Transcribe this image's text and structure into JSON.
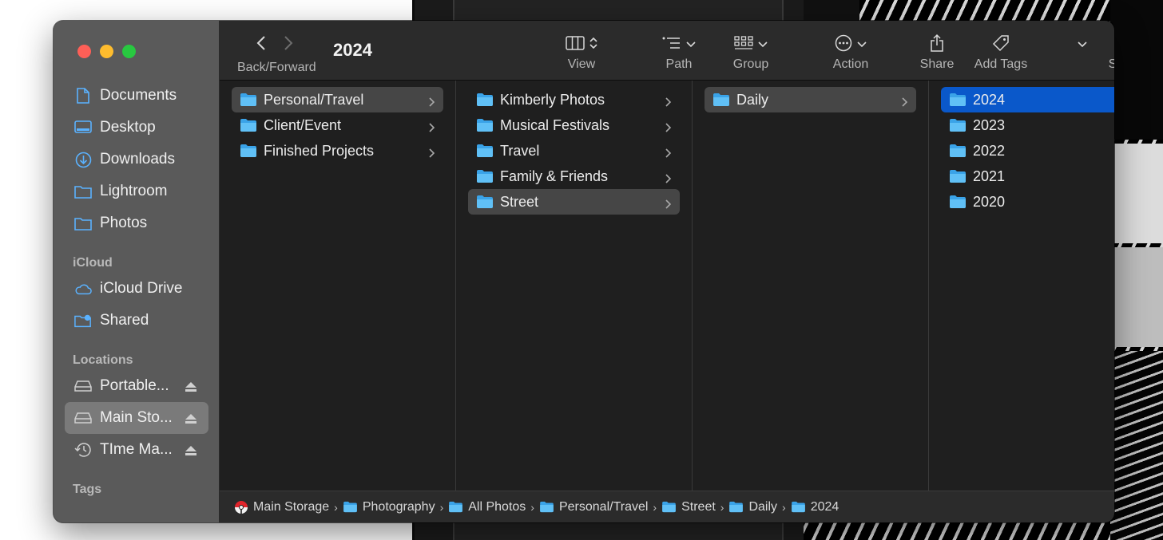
{
  "window": {
    "title": "2024",
    "accent": "#0a58ca"
  },
  "toolbar": {
    "back_forward_label": "Back/Forward",
    "buttons": [
      {
        "label": "View",
        "icon": "columns-view-icon"
      },
      {
        "label": "Path",
        "icon": "path-list-icon"
      },
      {
        "label": "Group",
        "icon": "group-grid-icon"
      },
      {
        "label": "Action",
        "icon": "ellipsis-circle-icon"
      },
      {
        "label": "Share",
        "icon": "share-icon"
      },
      {
        "label": "Add Tags",
        "icon": "tag-icon"
      },
      {
        "label": "Search",
        "icon": "search-icon"
      }
    ]
  },
  "sidebar": {
    "favorites": [
      {
        "label": "Documents",
        "icon": "document-icon"
      },
      {
        "label": "Desktop",
        "icon": "desktop-icon"
      },
      {
        "label": "Downloads",
        "icon": "download-icon"
      },
      {
        "label": "Lightroom",
        "icon": "folder-icon"
      },
      {
        "label": "Photos",
        "icon": "folder-icon"
      }
    ],
    "icloud_label": "iCloud",
    "icloud": [
      {
        "label": "iCloud Drive",
        "icon": "cloud-icon"
      },
      {
        "label": "Shared",
        "icon": "shared-folder-icon"
      }
    ],
    "locations_label": "Locations",
    "locations": [
      {
        "label": "Portable...",
        "icon": "drive-icon"
      },
      {
        "label": "Main Sto...",
        "icon": "drive-icon"
      },
      {
        "label": "TIme Ma...",
        "icon": "time-machine-icon"
      }
    ],
    "tags_label": "Tags"
  },
  "columns": [
    {
      "items": [
        "Personal/Travel",
        "Client/Event",
        "Finished Projects"
      ]
    },
    {
      "items": [
        "Kimberly Photos",
        "Musical Festivals",
        "Travel",
        "Family & Friends",
        "Street"
      ]
    },
    {
      "items": [
        "Daily"
      ]
    },
    {
      "items": [
        "2024",
        "2023",
        "2022",
        "2021",
        "2020"
      ]
    }
  ],
  "pathbar": {
    "crumbs": [
      "Main Storage",
      "Photography",
      "All Photos",
      "Personal/Travel",
      "Street",
      "Daily",
      "2024"
    ]
  }
}
